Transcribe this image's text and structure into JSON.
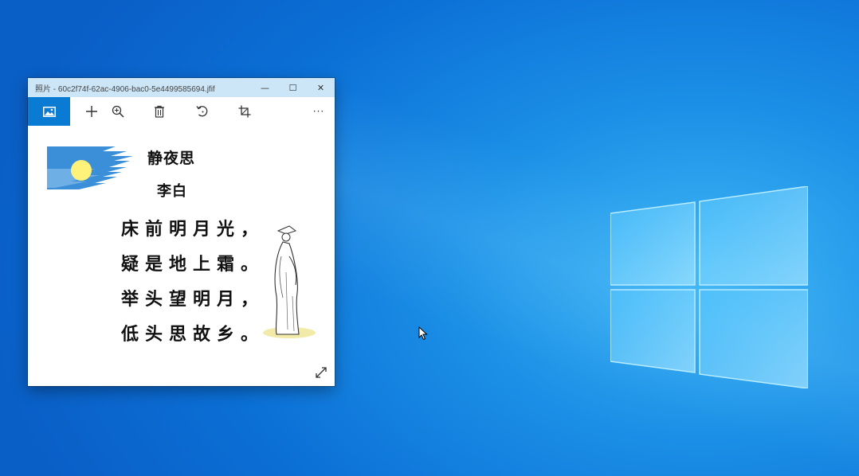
{
  "window": {
    "title": "照片 - 60c2f74f-62ac-4906-bac0-5e4499585694.jfif",
    "minimize_glyph": "—",
    "maximize_glyph": "☐",
    "close_glyph": "✕"
  },
  "toolbar": {
    "items": [
      {
        "icon": "picture-icon"
      },
      {
        "icon": "add-icon"
      },
      {
        "icon": "zoom-icon"
      },
      {
        "icon": "delete-icon"
      },
      {
        "icon": "rotate-icon"
      },
      {
        "icon": "crop-icon"
      }
    ],
    "more_glyph": "···"
  },
  "poem": {
    "title": "静夜思",
    "author": "李白",
    "lines": [
      "床前明月光，",
      "疑是地上霜。",
      "举头望明月，",
      "低头思故乡。"
    ]
  },
  "colors": {
    "accent": "#0a7bd2",
    "titlebar": "#cde6f7",
    "moon": "#fff27a",
    "cloud": "#3b8fd8"
  }
}
